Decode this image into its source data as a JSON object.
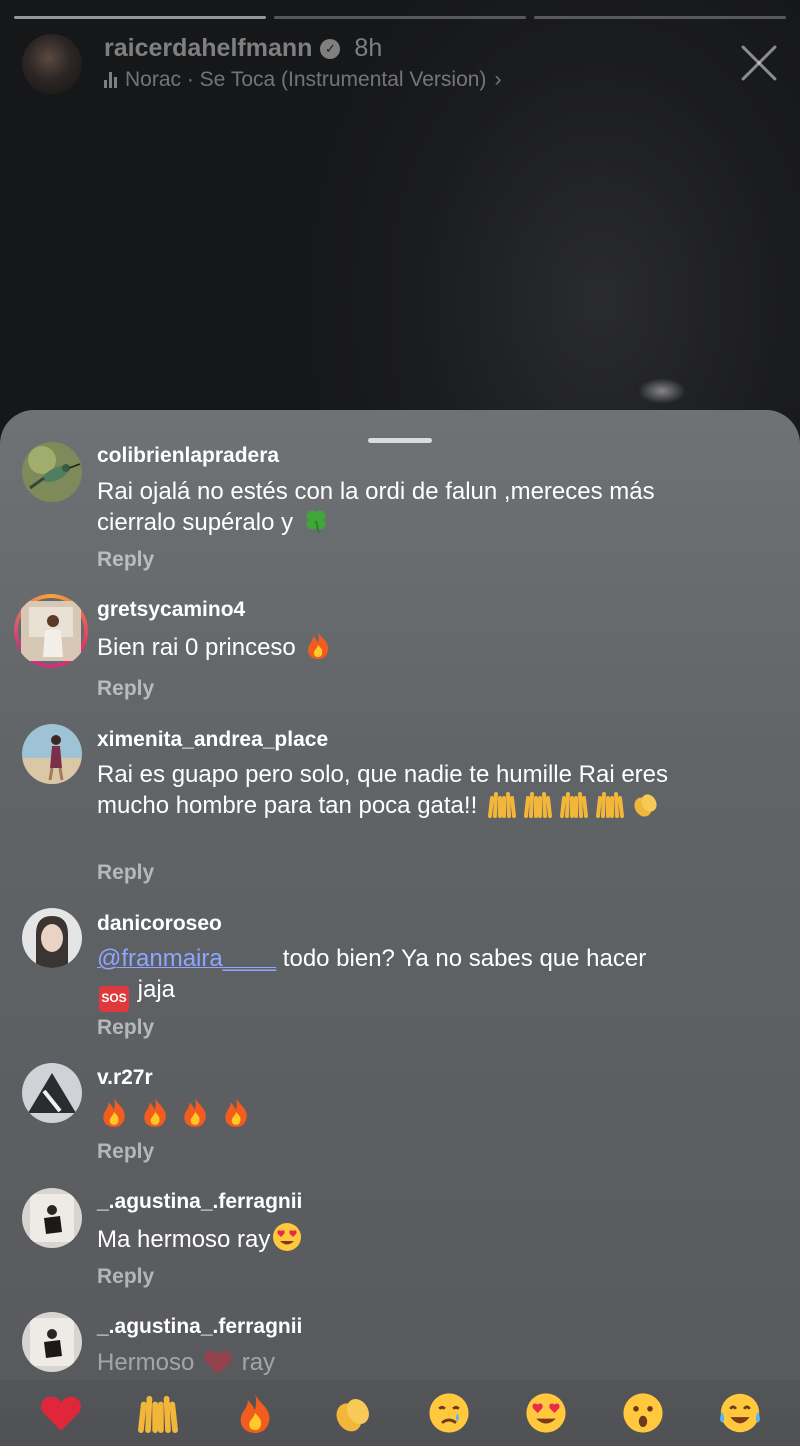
{
  "story": {
    "username": "raicerdahelfmann",
    "time": "8h",
    "music": "Norac · Se Toca (Instrumental Version)",
    "music_chevron": "›",
    "progress_segments": [
      {
        "state": "complete"
      },
      {
        "state": "viewing"
      },
      {
        "state": "upcoming"
      }
    ]
  },
  "comments": [
    {
      "username": "colibrienlapradera",
      "text": "Rai ojalá no estés con la ordi de falun ,mereces más cierralo supéralo y",
      "emoji": [
        "four-leaf-clover"
      ],
      "reply": "Reply",
      "avatar": "hummingbird-photo"
    },
    {
      "username": "gretsycamino4",
      "text": "Bien rai 0 princeso",
      "emoji": [
        "fire"
      ],
      "reply": "Reply",
      "avatar": "woman-photo-story-ring"
    },
    {
      "username": "ximenita_andrea_place",
      "text": "Rai es guapo pero solo, que nadie te humille Rai eres mucho hombre para tan poca gata!!",
      "emoji": [
        "raising-hands",
        "raising-hands",
        "raising-hands",
        "raising-hands",
        "clapping-hands"
      ],
      "reply": "Reply",
      "avatar": "beach-photo"
    },
    {
      "username": "danicoroseo",
      "mention": "@franmaira____",
      "text": "todo bien? Ya no sabes que hacer",
      "sos_label": "SOS",
      "text_after": "jaja",
      "reply": "Reply",
      "avatar": "selfie-photo"
    },
    {
      "username": "v.r27r",
      "emoji": [
        "fire",
        "fire",
        "fire",
        "fire"
      ],
      "reply": "Reply",
      "avatar": "bw-photo"
    },
    {
      "username": "_.agustina_.ferragnii",
      "text": "Ma hermoso ray",
      "emoji": [
        "heart-eyes"
      ],
      "reply": "Reply",
      "avatar": "mirror-selfie"
    },
    {
      "username": "_.agustina_.ferragnii",
      "text": "Hermoso",
      "text_after": "ray",
      "emoji": [
        "red-heart"
      ],
      "avatar": "mirror-selfie"
    }
  ],
  "reactions": [
    "red-heart",
    "raising-hands",
    "fire",
    "clapping-hands",
    "crying-face",
    "heart-eyes",
    "surprised-face",
    "tears-of-joy"
  ],
  "colors": {
    "sheet": "#64676a",
    "mention": "#8ea6ff",
    "story_ring_start": "#f9a33a",
    "story_ring_end": "#c13584"
  }
}
